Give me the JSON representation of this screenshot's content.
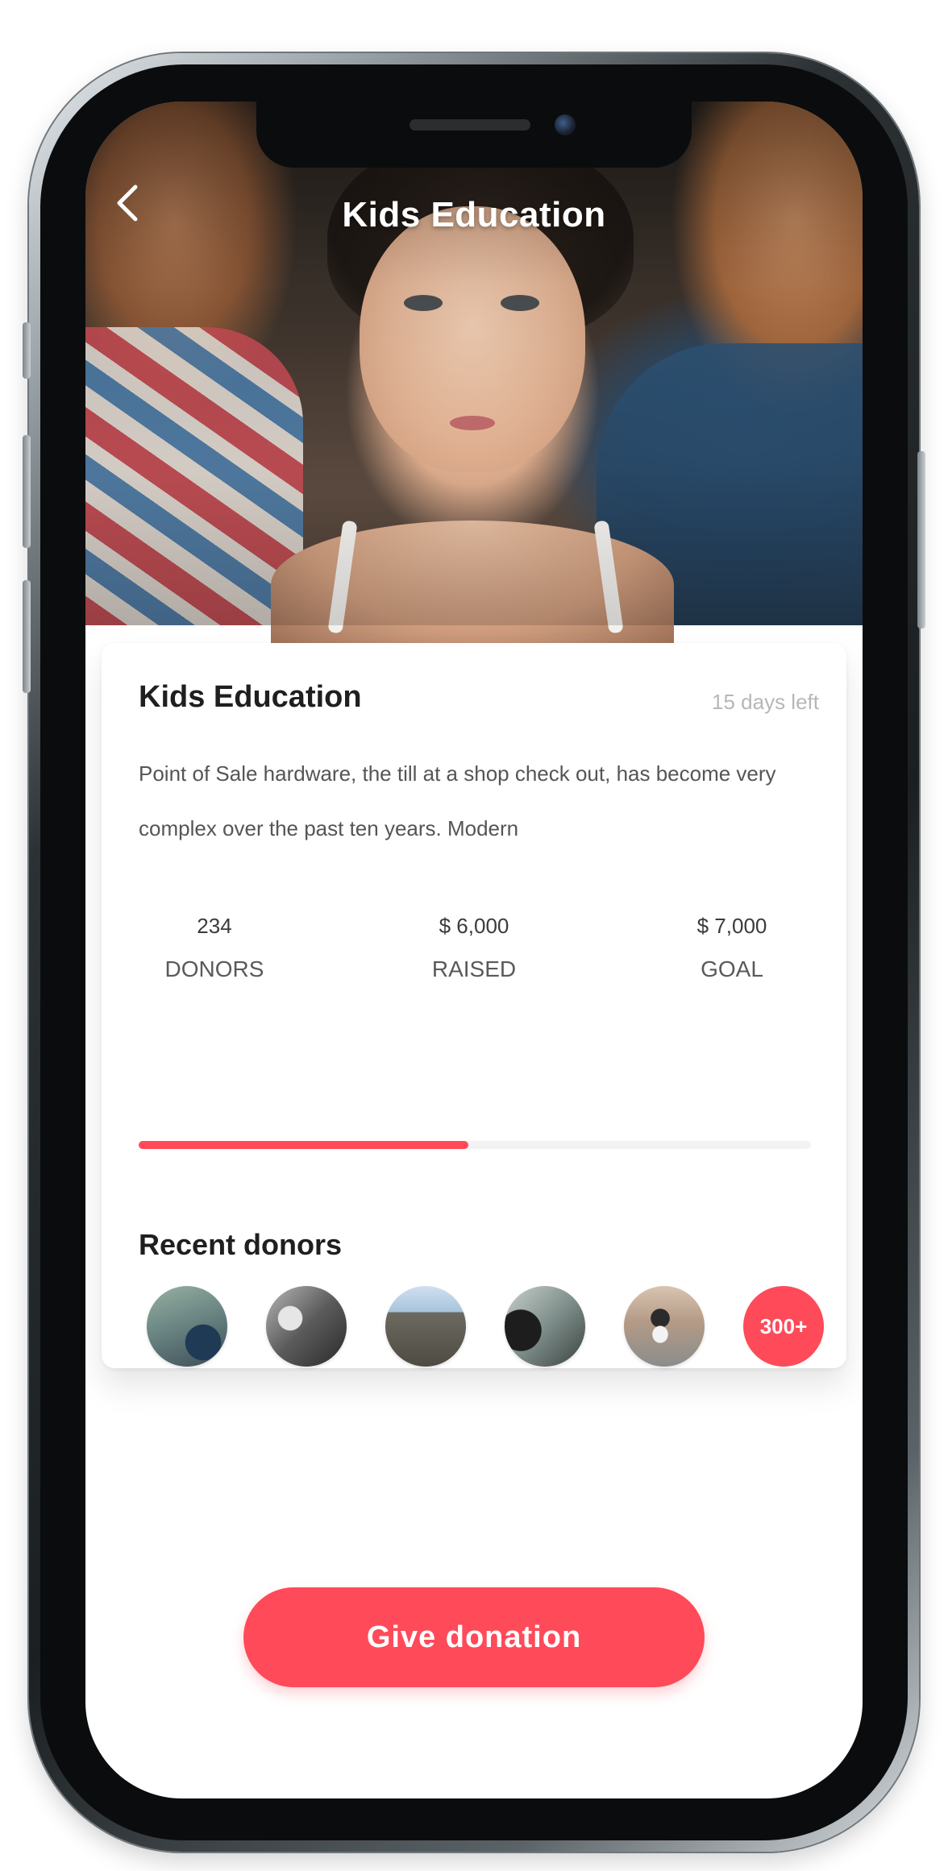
{
  "header": {
    "title": "Kids Education",
    "back_icon": "chevron-left-icon"
  },
  "campaign": {
    "title": "Kids Education",
    "days_left": "15 days left",
    "description": "Point of Sale hardware, the till at a shop check out, has become very complex over the past ten years. Modern",
    "stats": {
      "donors": {
        "value": "234",
        "label": "DONORS"
      },
      "raised": {
        "value": "$ 6,000",
        "label": "RAISED"
      },
      "goal": {
        "value": "$ 7,000",
        "label": "GOAL"
      }
    },
    "progress_fraction": 0.49
  },
  "recent_donors": {
    "title": "Recent donors",
    "more_label": "300+"
  },
  "cta": {
    "label": "Give donation"
  },
  "colors": {
    "accent": "#ff4a5a",
    "muted_text": "#b7b7b7",
    "body_text": "#555555"
  }
}
